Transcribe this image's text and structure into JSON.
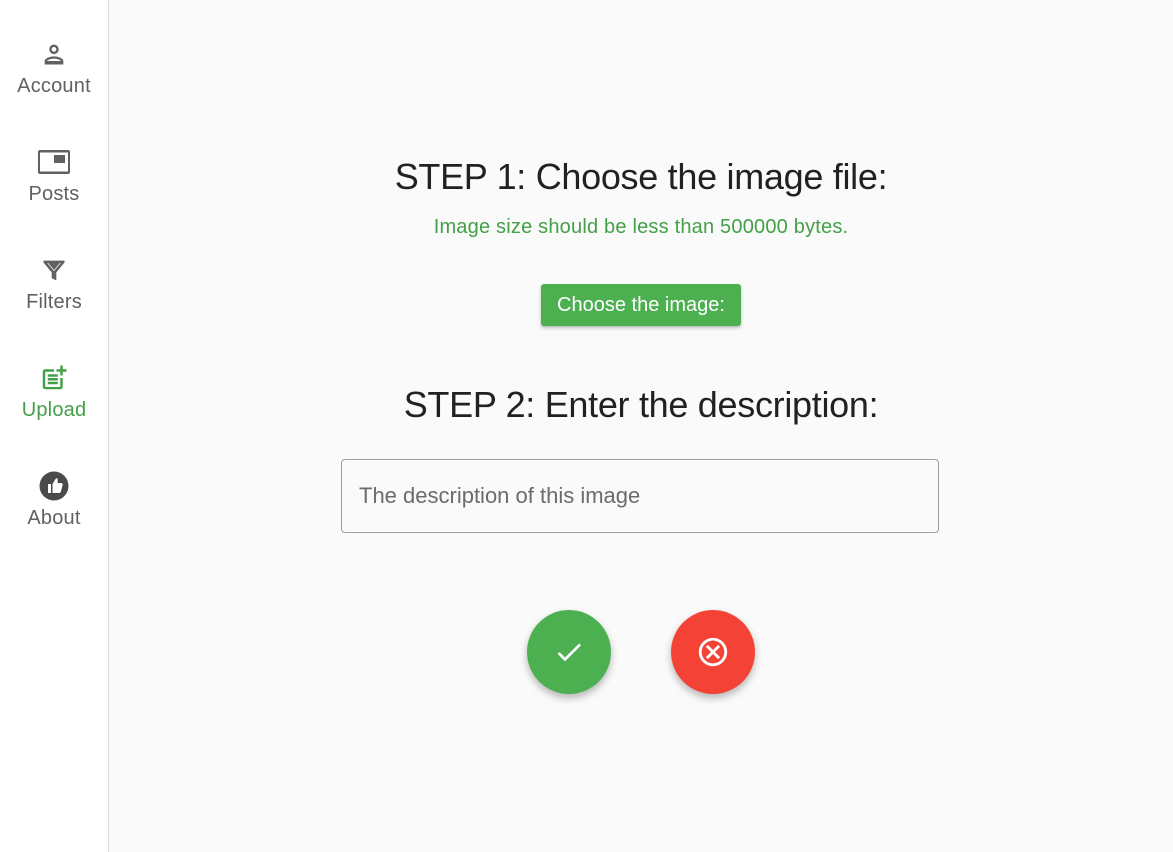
{
  "sidebar": {
    "items": [
      {
        "label": "Account",
        "icon": "person-icon",
        "active": false
      },
      {
        "label": "Posts",
        "icon": "picture-in-picture-icon",
        "active": false
      },
      {
        "label": "Filters",
        "icon": "filter-icon",
        "active": false
      },
      {
        "label": "Upload",
        "icon": "post-add-icon",
        "active": true
      },
      {
        "label": "About",
        "icon": "thumb-up-icon",
        "active": false
      }
    ]
  },
  "main": {
    "step1_title": "STEP 1: Choose the image file:",
    "size_hint": "Image size should be less than 500000 bytes.",
    "choose_button_label": "Choose the image:",
    "step2_title": "STEP 2: Enter the description:",
    "description_placeholder": "The description of this image",
    "description_value": "",
    "confirm_icon": "check-icon",
    "cancel_icon": "cancel-circle-icon"
  },
  "colors": {
    "accent_green": "#4caf50",
    "hint_green": "#43a047",
    "cancel_red": "#f44336",
    "text_gray": "#616161"
  }
}
